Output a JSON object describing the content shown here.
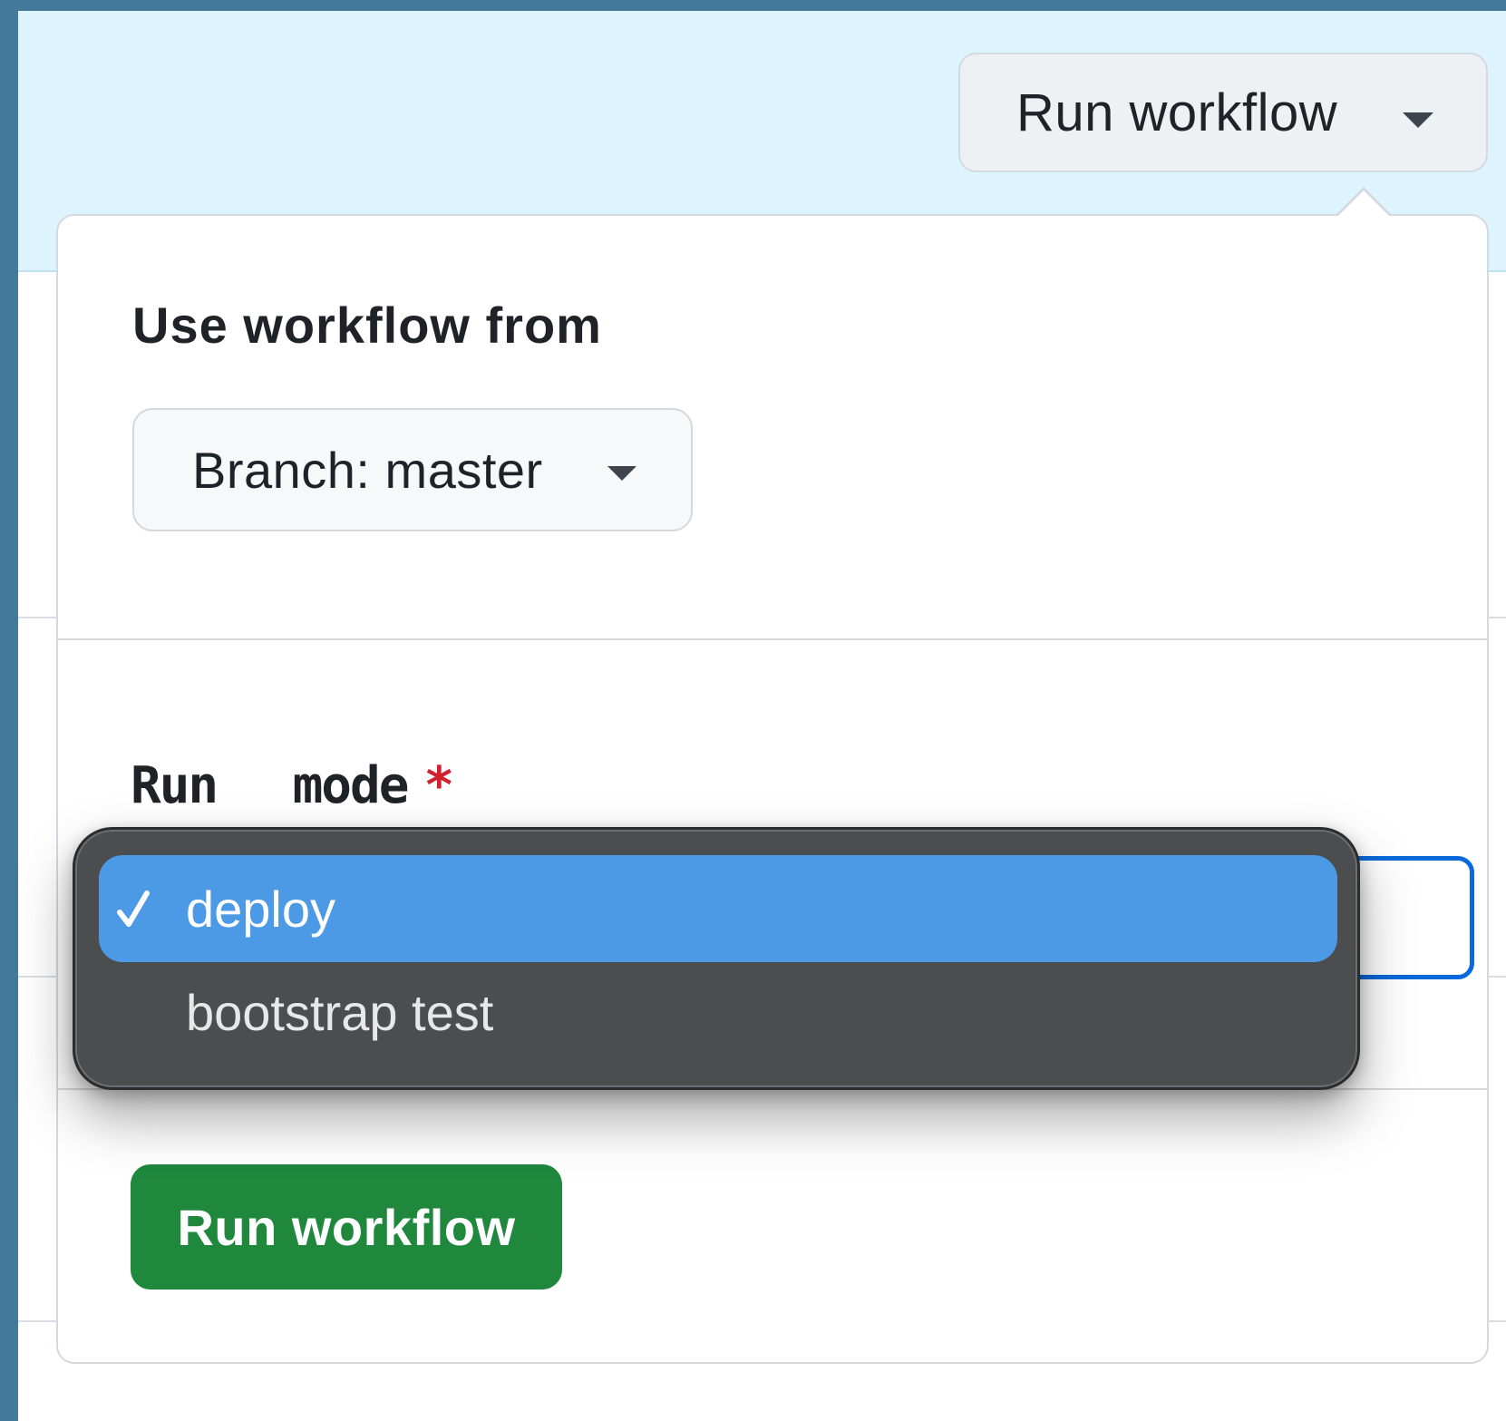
{
  "header": {
    "run_workflow_label": "Run workflow"
  },
  "popover": {
    "use_workflow_from_label": "Use workflow from",
    "branch_button_label": "Branch: master",
    "run_mode_label": "Run  mode",
    "required_mark": "*",
    "run_button_label": "Run workflow"
  },
  "dropdown": {
    "options": [
      {
        "label": "deploy",
        "selected": true
      },
      {
        "label": "bootstrap test",
        "selected": false
      }
    ]
  },
  "colors": {
    "header_band": "#ddf3fd",
    "run_button": "#1f883d",
    "required_mark": "#cf222e",
    "selected_option": "#4c99e6",
    "menu_bg": "#4b4d4e",
    "focus_border": "#0969da"
  }
}
